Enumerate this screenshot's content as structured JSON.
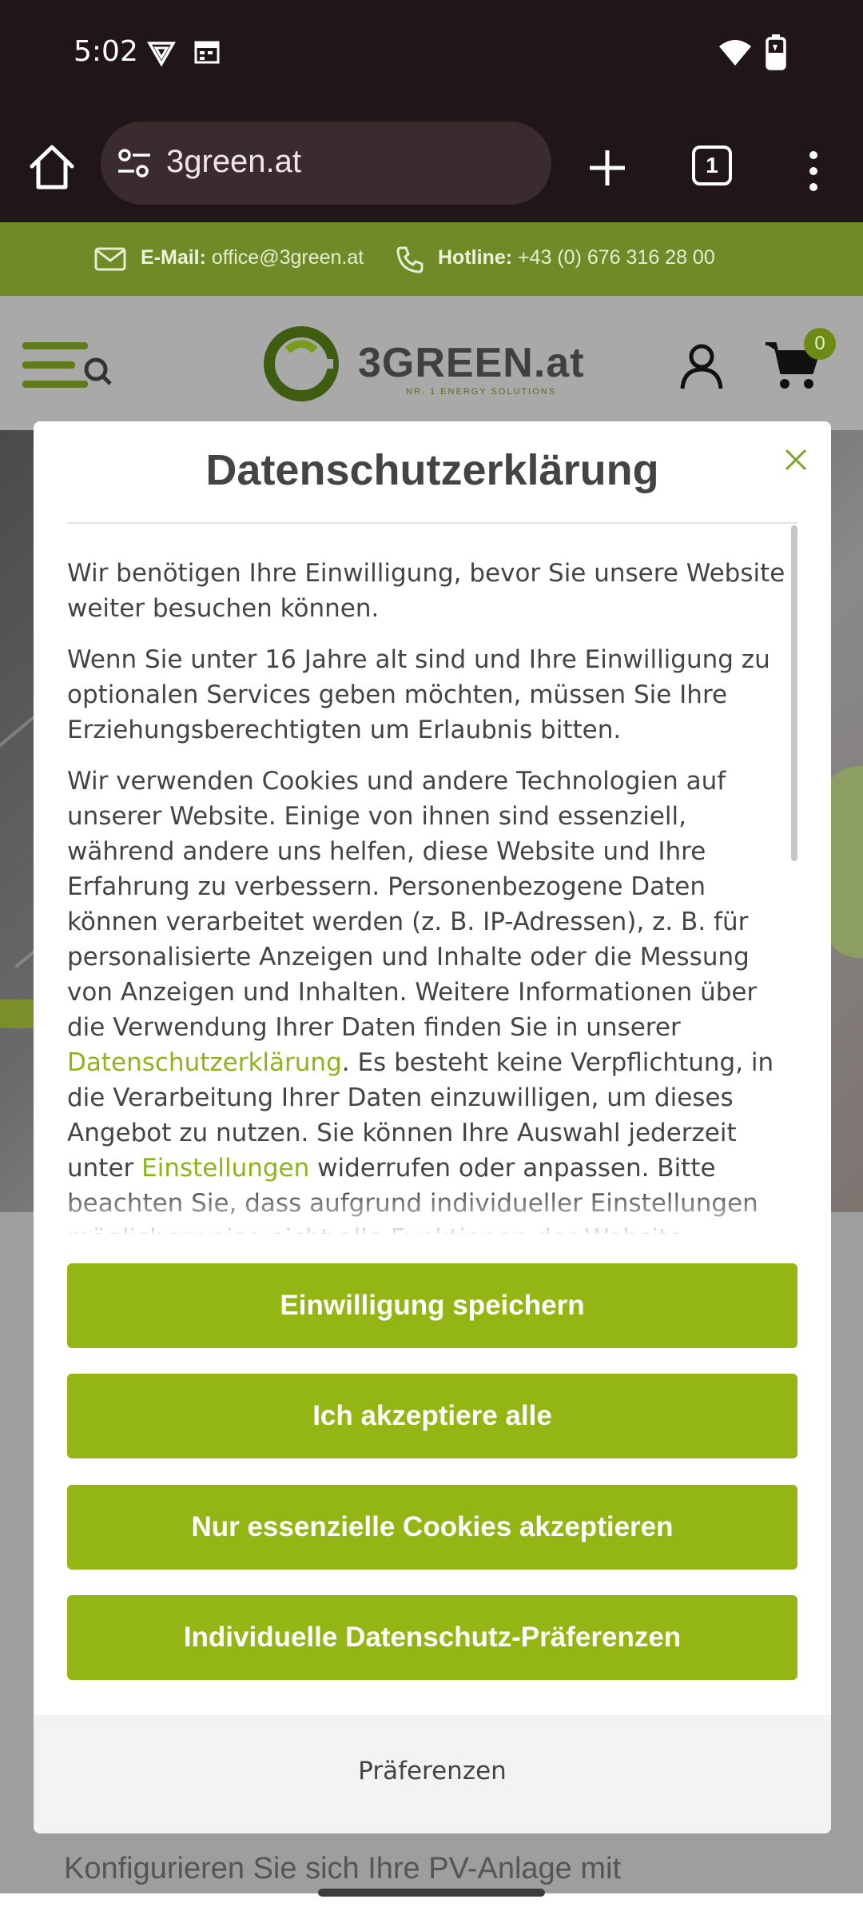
{
  "status_bar": {
    "time": "5:02",
    "icons": [
      "vpn-icon",
      "calendar-icon",
      "wifi-icon",
      "battery-icon"
    ]
  },
  "browser": {
    "url": "3green.at",
    "tab_count": "1",
    "icons": [
      "home-icon",
      "site-settings-icon",
      "new-tab-icon",
      "tab-switcher-icon",
      "overflow-menu-icon"
    ]
  },
  "site": {
    "email_label": "E-Mail:",
    "email_value": "office@3green.at",
    "hotline_label": "Hotline:",
    "hotline_value": "+43 (0) 676 316 28 00",
    "logo_text": "3GREEN.at",
    "logo_tagline": "NR. 1 ENERGY SOLUTIONS",
    "cart_count": "0",
    "below_text": "Konfigurieren Sie sich Ihre PV-Anlage mit"
  },
  "modal": {
    "title": "Datenschutzerklärung",
    "para1": "Wir benötigen Ihre Einwilligung, bevor Sie unsere Website weiter besuchen können.",
    "para2": "Wenn Sie unter 16 Jahre alt sind und Ihre Einwilligung zu optionalen Services geben möchten, müssen Sie Ihre Erziehungsberechtigten um Erlaubnis bitten.",
    "para3_part1": "Wir verwenden Cookies und andere Technologien auf unserer Website. Einige von ihnen sind essenziell, während andere uns helfen, diese Website und Ihre Erfahrung zu verbessern. Personenbezogene Daten können verarbeitet werden (z. B. IP-Adressen), z. B. für personalisierte Anzeigen und Inhalte oder die Messung von Anzeigen und Inhalten. Weitere Informationen über die Verwendung Ihrer Daten finden Sie in unserer ",
    "link_privacy": "Datenschutzerklärung",
    "para3_part2": ". Es besteht keine Verpflichtung, in die Verarbeitung Ihrer Daten einzuwilligen, um dieses Angebot zu nutzen. Sie können Ihre Auswahl jederzeit unter ",
    "link_settings": "Einstellungen",
    "para3_part3": " widerrufen oder anpassen. Bitte beachten Sie, dass aufgrund individueller Einstellungen möglicherweise nicht alle Funktionen der Website verfügbar",
    "buttons": {
      "save": "Einwilligung speichern",
      "accept_all": "Ich akzeptiere alle",
      "essential_only": "Nur essenzielle Cookies akzeptieren",
      "individual": "Individuelle Datenschutz-Präferenzen"
    },
    "footer_link": "Präferenzen"
  },
  "colors": {
    "accent": "#93b614",
    "link": "#8eb41c",
    "browser_bg": "#201518"
  }
}
